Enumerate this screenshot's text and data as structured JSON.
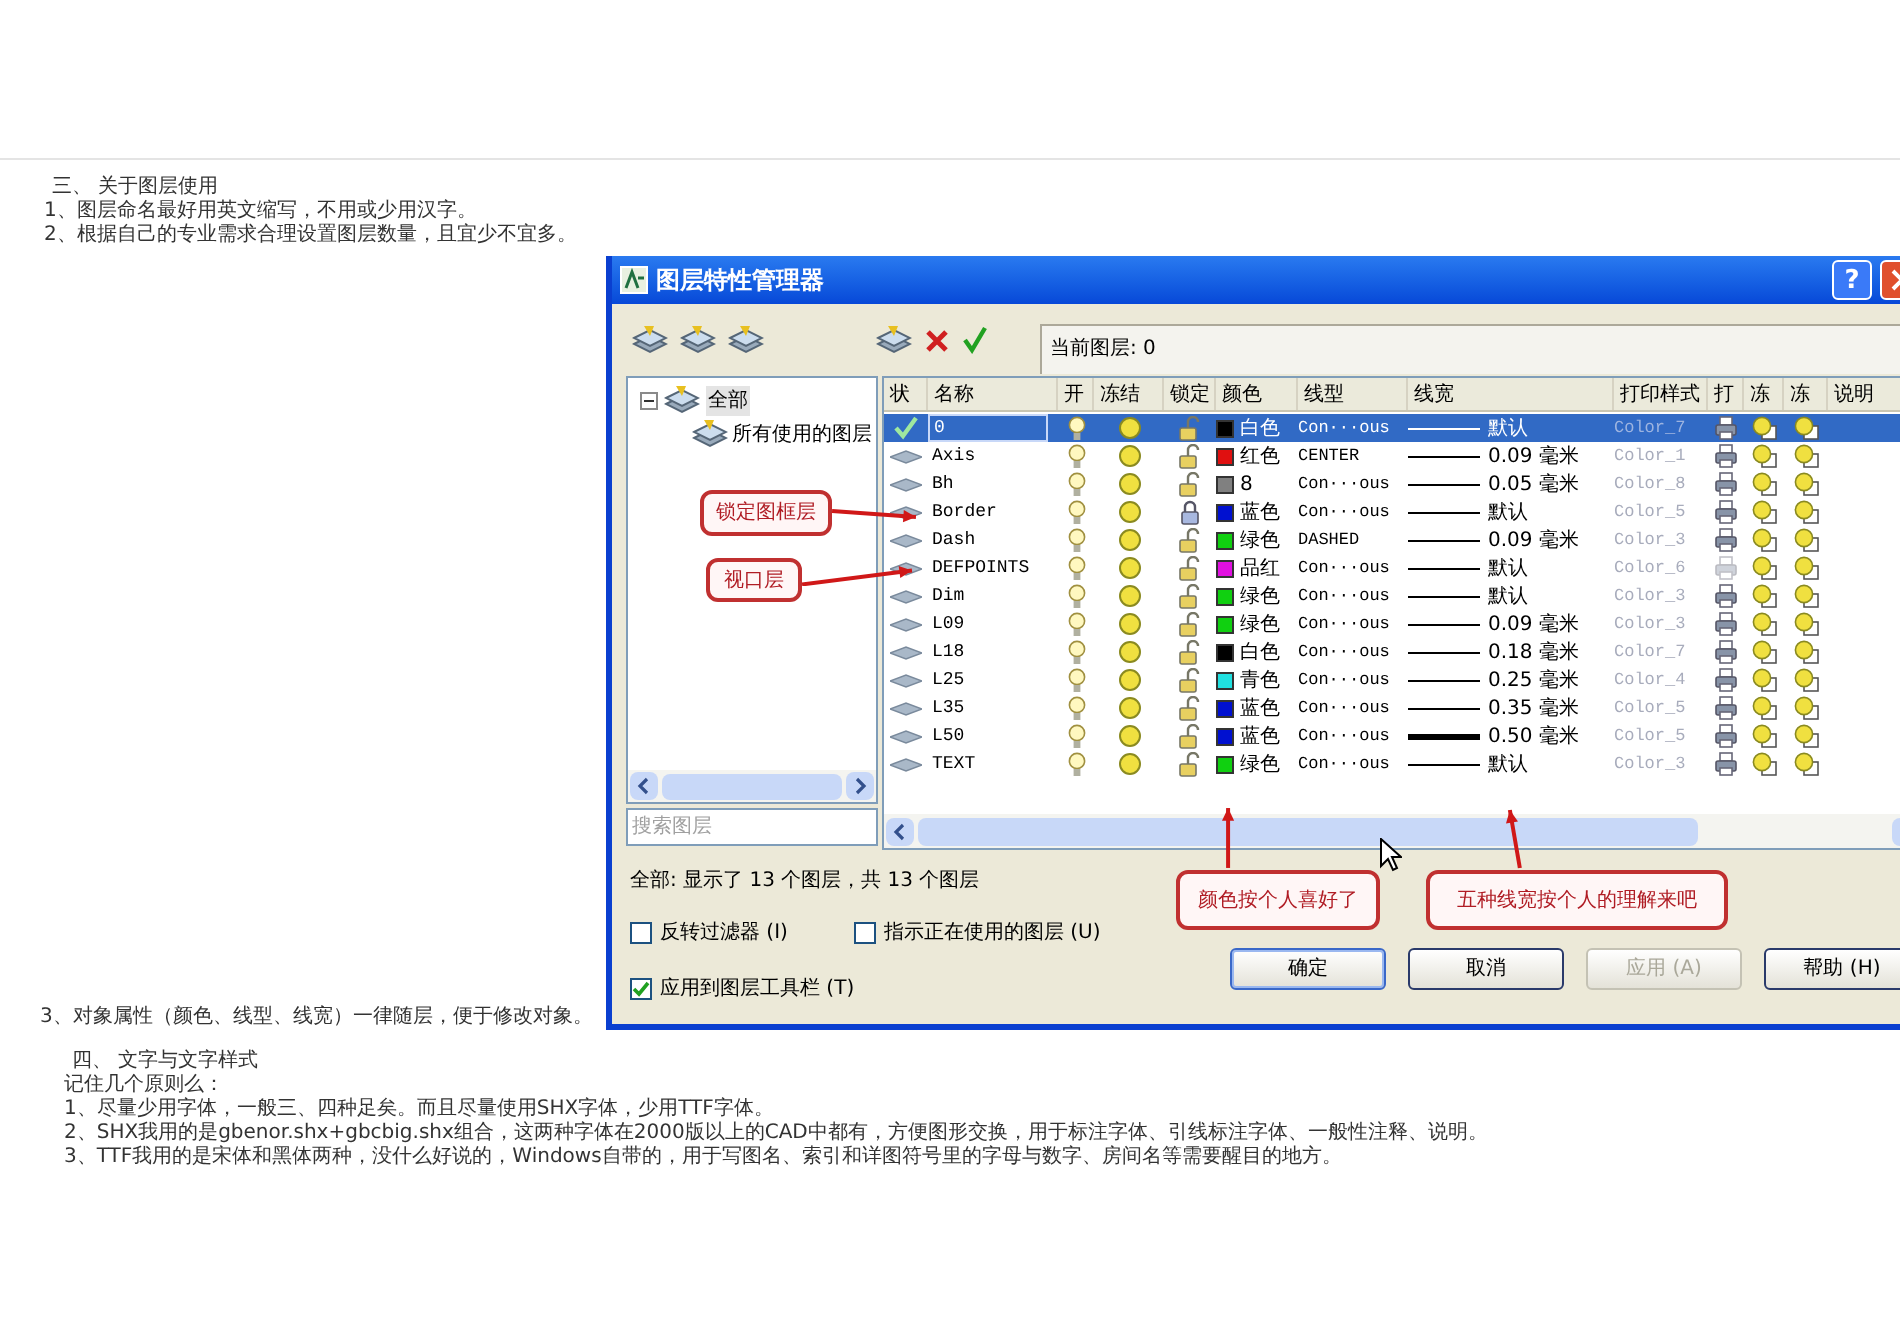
{
  "document": {
    "intro": [
      "三、 关于图层使用",
      "1、图层命名最好用英文缩写，不用或少用汉字。",
      "2、根据自己的专业需求合理设置图层数量，且宜少不宜多。"
    ],
    "side_note": "3、对象属性（颜色、线型、线宽）一律随层，便于修改对象。",
    "section_four": [
      "四、 文字与文字样式",
      "记住几个原则么：",
      "1、尽量少用字体，一般三、四种足矣。而且尽量使用SHX字体，少用TTF字体。",
      "2、SHX我用的是gbenor.shx+gbcbig.shx组合，这两种字体在2000版以上的CAD中都有，方便图形交换，用于标注字体、引线标注字体、一般性注释、说明。",
      "3、TTF我用的是宋体和黑体两种，没什么好说的，Windows自带的，用于写图名、索引和详图符号里的字母与数字、房间名等需要醒目的地方。"
    ]
  },
  "dialog": {
    "title": "图层特性管理器",
    "help_button": "?",
    "current_layer": "当前图层: 0",
    "tree": [
      {
        "label": "全部",
        "expanded": true,
        "selected": true,
        "children": [
          {
            "label": "所有使用的图层",
            "selected": false
          }
        ]
      }
    ],
    "search": {
      "placeholder": "搜索图层"
    },
    "table": {
      "columns": [
        "状",
        "名称",
        "开",
        "冻结",
        "锁定",
        "颜色",
        "线型",
        "线宽",
        "打印样式",
        "打",
        "冻",
        "冻",
        "说明"
      ],
      "rows": [
        {
          "selected": true,
          "current": true,
          "name": "0",
          "locked": false,
          "color": "#000000",
          "color_name": "白色",
          "linetype": "Con···ous",
          "heavy_line": false,
          "lineweight": "默认",
          "plot_style": "Color_7",
          "plot": true
        },
        {
          "selected": false,
          "current": false,
          "name": "Axis",
          "locked": false,
          "color": "#e01010",
          "color_name": "红色",
          "linetype": "CENTER",
          "heavy_line": false,
          "lineweight": "0.09 毫米",
          "plot_style": "Color_1",
          "plot": true
        },
        {
          "selected": false,
          "current": false,
          "name": "Bh",
          "locked": false,
          "color": "#808080",
          "color_name": "8",
          "linetype": "Con···ous",
          "heavy_line": false,
          "lineweight": "0.05 毫米",
          "plot_style": "Color_8",
          "plot": true
        },
        {
          "selected": false,
          "current": false,
          "name": "Border",
          "locked": true,
          "color": "#0010d0",
          "color_name": "蓝色",
          "linetype": "Con···ous",
          "heavy_line": false,
          "lineweight": "默认",
          "plot_style": "Color_5",
          "plot": true
        },
        {
          "selected": false,
          "current": false,
          "name": "Dash",
          "locked": false,
          "color": "#10d010",
          "color_name": "绿色",
          "linetype": "DASHED",
          "heavy_line": false,
          "lineweight": "0.09 毫米",
          "plot_style": "Color_3",
          "plot": true
        },
        {
          "selected": false,
          "current": false,
          "name": "DEFPOINTS",
          "locked": false,
          "color": "#e010e0",
          "color_name": "品红",
          "linetype": "Con···ous",
          "heavy_line": false,
          "lineweight": "默认",
          "plot_style": "Color_6",
          "plot": false
        },
        {
          "selected": false,
          "current": false,
          "name": "Dim",
          "locked": false,
          "color": "#10d010",
          "color_name": "绿色",
          "linetype": "Con···ous",
          "heavy_line": false,
          "lineweight": "默认",
          "plot_style": "Color_3",
          "plot": true
        },
        {
          "selected": false,
          "current": false,
          "name": "L09",
          "locked": false,
          "color": "#10d010",
          "color_name": "绿色",
          "linetype": "Con···ous",
          "heavy_line": false,
          "lineweight": "0.09 毫米",
          "plot_style": "Color_3",
          "plot": true
        },
        {
          "selected": false,
          "current": false,
          "name": "L18",
          "locked": false,
          "color": "#000000",
          "color_name": "白色",
          "linetype": "Con···ous",
          "heavy_line": false,
          "lineweight": "0.18 毫米",
          "plot_style": "Color_7",
          "plot": true
        },
        {
          "selected": false,
          "current": false,
          "name": "L25",
          "locked": false,
          "color": "#20e0e0",
          "color_name": "青色",
          "linetype": "Con···ous",
          "heavy_line": false,
          "lineweight": "0.25 毫米",
          "plot_style": "Color_4",
          "plot": true
        },
        {
          "selected": false,
          "current": false,
          "name": "L35",
          "locked": false,
          "color": "#0010d0",
          "color_name": "蓝色",
          "linetype": "Con···ous",
          "heavy_line": false,
          "lineweight": "0.35 毫米",
          "plot_style": "Color_5",
          "plot": true
        },
        {
          "selected": false,
          "current": false,
          "name": "L50",
          "locked": false,
          "color": "#0010d0",
          "color_name": "蓝色",
          "linetype": "Con···ous",
          "heavy_line": true,
          "lineweight": "0.50 毫米",
          "plot_style": "Color_5",
          "plot": true
        },
        {
          "selected": false,
          "current": false,
          "name": "TEXT",
          "locked": false,
          "color": "#10d010",
          "color_name": "绿色",
          "linetype": "Con···ous",
          "heavy_line": false,
          "lineweight": "默认",
          "plot_style": "Color_3",
          "plot": true
        }
      ]
    },
    "status": "全部: 显示了 13 个图层，共 13 个图层",
    "checkboxes": [
      {
        "label": "反转过滤器 (I)",
        "checked": false
      },
      {
        "label": "指示正在使用的图层 (U)",
        "checked": false
      },
      {
        "label": "应用到图层工具栏 (T)",
        "checked": true
      }
    ],
    "buttons": [
      {
        "label": "确定",
        "default": true,
        "disabled": false
      },
      {
        "label": "取消",
        "default": false,
        "disabled": false
      },
      {
        "label": "应用 (A)",
        "default": false,
        "disabled": true
      },
      {
        "label": "帮助 (H)",
        "default": false,
        "disabled": false
      }
    ],
    "callouts": [
      {
        "text": "锁定图框层"
      },
      {
        "text": "视口层"
      },
      {
        "text": "颜色按个人喜好了"
      },
      {
        "text": "五种线宽按个人的理解来吧"
      }
    ]
  }
}
